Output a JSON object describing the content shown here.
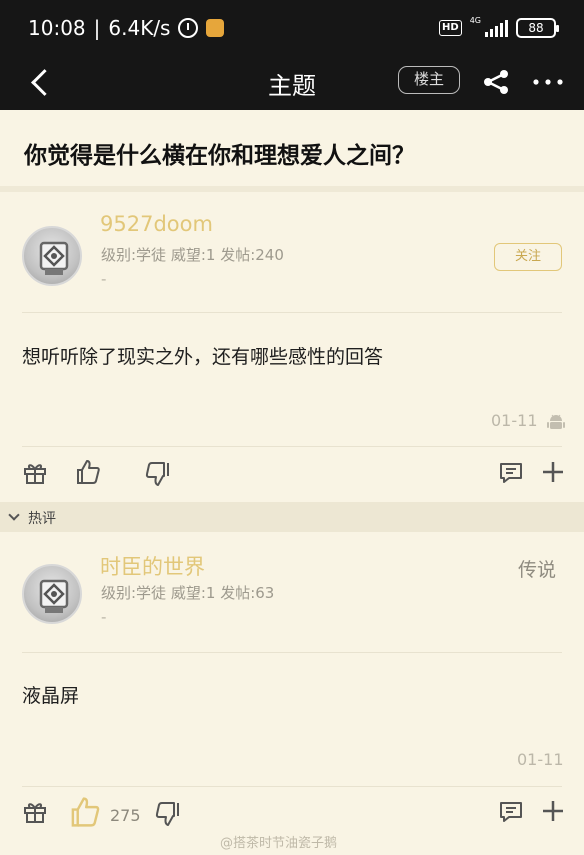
{
  "status_bar": {
    "time": "10:08",
    "speed": "6.4K/s",
    "hd": "HD",
    "network": "4G",
    "battery": "88"
  },
  "nav": {
    "title": "主题",
    "op_label": "楼主"
  },
  "question": "你觉得是什么横在你和理想爱人之间？",
  "post": {
    "username": "9527doom",
    "info": "级别:学徒 威望:1 发帖:240",
    "dash": "-",
    "follow_label": "关注",
    "content": "想听听除了现实之外，还有哪些感性的回答",
    "date": "01-11"
  },
  "hot_label": "热评",
  "reply": {
    "username": "时臣的世界",
    "rank": "传说",
    "info": "级别:学徒 威望:1 发帖:63",
    "dash": "-",
    "content": "液晶屏",
    "date": "01-11",
    "likes": "275"
  },
  "watermark": "@搭茶时节油瓷子鹅",
  "colors": {
    "header_bg": "#161616",
    "page_bg": "#f9f4e4",
    "accent_gold": "#e2c779"
  }
}
